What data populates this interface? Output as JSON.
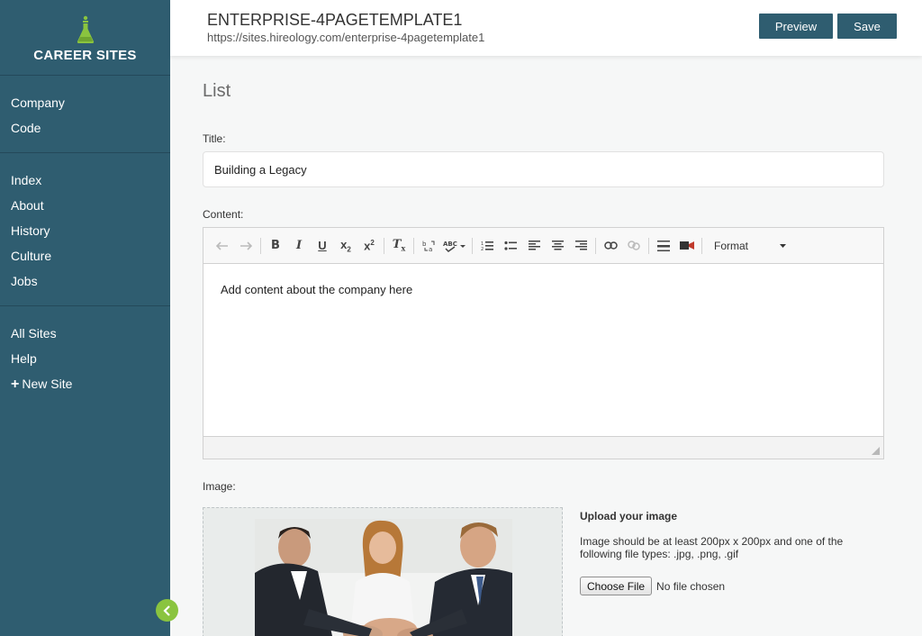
{
  "brand": {
    "name": "CAREER SITES",
    "logo_icon": "flask-icon",
    "accent": "#8ac43f"
  },
  "sidebar": {
    "groups": [
      {
        "items": [
          {
            "label": "Company"
          },
          {
            "label": "Code"
          }
        ]
      },
      {
        "items": [
          {
            "label": "Index"
          },
          {
            "label": "About"
          },
          {
            "label": "History"
          },
          {
            "label": "Culture"
          },
          {
            "label": "Jobs"
          }
        ]
      },
      {
        "items": [
          {
            "label": "All Sites"
          },
          {
            "label": "Help"
          },
          {
            "label": "New Site",
            "icon": "plus-icon"
          }
        ]
      }
    ],
    "color": "#2f5d70",
    "collapse_icon": "chevron-left-icon"
  },
  "header": {
    "title": "ENTERPRISE-4PAGETEMPLATE1",
    "url": "https://sites.hireology.com/enterprise-4pagetemplate1",
    "preview_label": "Preview",
    "save_label": "Save"
  },
  "page": {
    "section_title": "List",
    "title_label": "Title:",
    "title_value": "Building a Legacy",
    "content_label": "Content:",
    "content_text": "Add content about the company here",
    "format_label": "Format",
    "image_label": "Image:"
  },
  "upload": {
    "title": "Upload your image",
    "description": "Image should be at least 200px x 200px and one of the following file types: .jpg, .png, .gif",
    "choose_label": "Choose File",
    "status": "No file chosen"
  }
}
